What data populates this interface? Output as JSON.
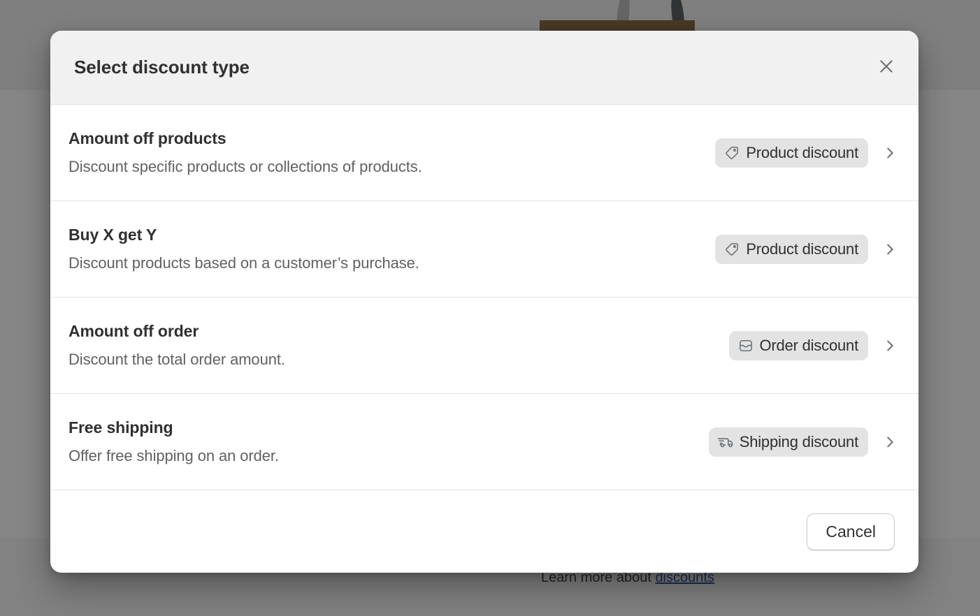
{
  "background": {
    "learn_more_prefix": "Learn more about ",
    "learn_more_link": "discounts",
    "link_color": "#1f3f8f",
    "product_image_name": "knife-block-thumbnail"
  },
  "modal": {
    "title": "Select discount type",
    "close_icon": "close-icon",
    "options": [
      {
        "title": "Amount off products",
        "description": "Discount specific products or collections of products.",
        "badge_label": "Product discount",
        "badge_icon": "tag-icon",
        "chevron_icon": "chevron-right-icon"
      },
      {
        "title": "Buy X get Y",
        "description": "Discount products based on a customer’s purchase.",
        "badge_label": "Product discount",
        "badge_icon": "tag-icon",
        "chevron_icon": "chevron-right-icon"
      },
      {
        "title": "Amount off order",
        "description": "Discount the total order amount.",
        "badge_label": "Order discount",
        "badge_icon": "inbox-icon",
        "chevron_icon": "chevron-right-icon"
      },
      {
        "title": "Free shipping",
        "description": "Offer free shipping on an order.",
        "badge_label": "Shipping discount",
        "badge_icon": "delivery-truck-icon",
        "chevron_icon": "chevron-right-icon"
      }
    ],
    "footer": {
      "cancel_label": "Cancel"
    },
    "colors": {
      "header_bg": "#f1f1f1",
      "badge_bg": "#e3e3e3",
      "title_text": "#303030",
      "description_text": "#616161",
      "divider": "#e3e3e3"
    }
  }
}
